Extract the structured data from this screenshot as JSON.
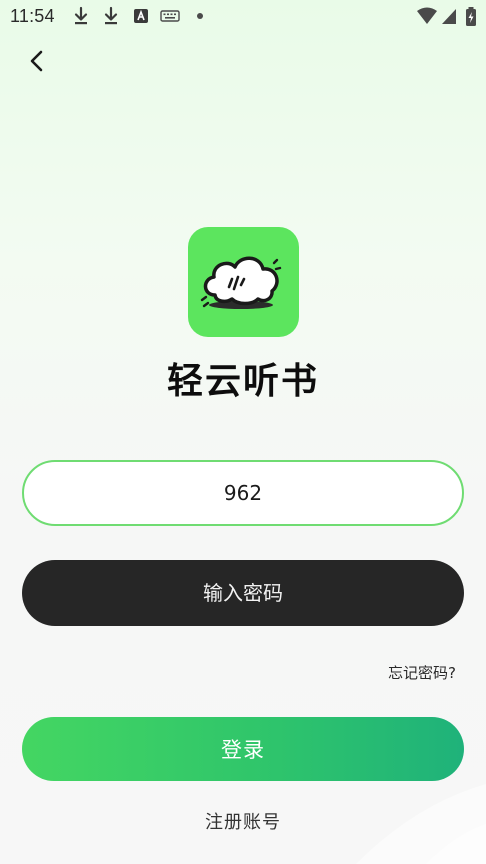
{
  "status_bar": {
    "time": "11:54",
    "icons": [
      "download-icon",
      "download-icon",
      "app-notification-icon",
      "keyboard-icon",
      "dot-icon",
      "wifi-icon",
      "cellular-signal-icon",
      "battery-charging-icon"
    ]
  },
  "app": {
    "name": "轻云听书",
    "logo_color": "#5ce55e"
  },
  "login_form": {
    "account_value": "962",
    "password_placeholder": "输入密码",
    "forgot_password_label": "忘记密码?",
    "login_label": "登录",
    "register_label": "注册账号"
  },
  "colors": {
    "accent_green": "#44d662",
    "field_border": "#6fdc72",
    "password_bg": "#262626"
  }
}
